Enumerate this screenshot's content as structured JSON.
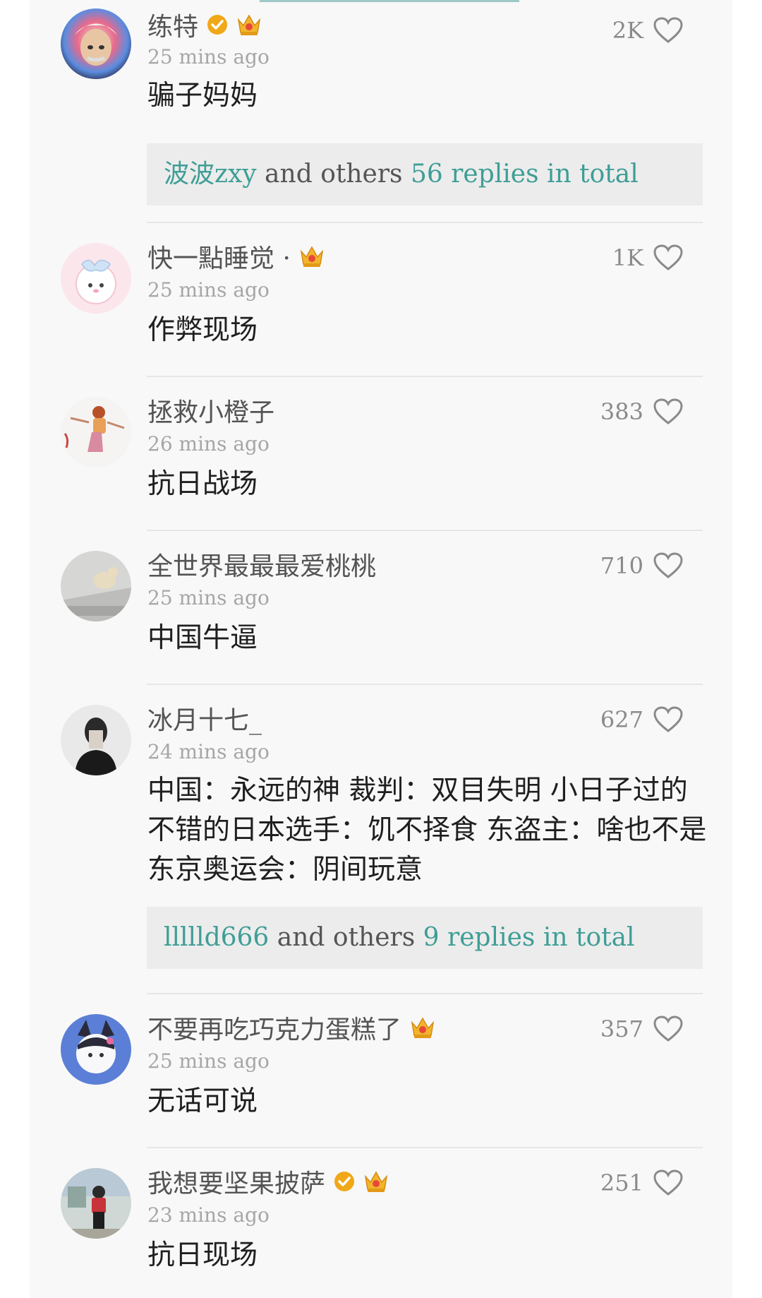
{
  "colors": {
    "accent": "#3f9e96",
    "verified": "#f0a818",
    "crown": "#f1b52c",
    "text": "#1f1f1f",
    "muted": "#a6a6a6"
  },
  "comments": [
    {
      "username": "练特",
      "badges": [
        "verified-icon",
        "crown-level-icon"
      ],
      "time": "25 mins ago",
      "likes": "2K",
      "text": "骗子妈妈",
      "replies": {
        "names": "波波zxy",
        "middle": " and others ",
        "total": "56 replies in total"
      }
    },
    {
      "username": "快一點睡觉 ·",
      "badges": [
        "crown-level-icon"
      ],
      "time": "25 mins ago",
      "likes": "1K",
      "text": "作弊现场"
    },
    {
      "username": "拯救小橙子",
      "badges": [],
      "time": "26 mins ago",
      "likes": "383",
      "text": "抗日战场"
    },
    {
      "username": "全世界最最最爱桃桃",
      "badges": [],
      "time": "25 mins ago",
      "likes": "710",
      "text": "中国牛逼"
    },
    {
      "username": "冰月十七_",
      "badges": [],
      "time": "24 mins ago",
      "likes": "627",
      "text": "中国：永远的神 裁判：双目失明 小日子过的不错的日本选手：饥不择食 东盗主：啥也不是 东京奥运会：阴间玩意",
      "replies": {
        "names": "llllld666",
        "middle": " and others ",
        "total": "9 replies in total"
      }
    },
    {
      "username": "不要再吃巧克力蛋糕了",
      "badges": [
        "crown-level-icon"
      ],
      "time": "25 mins ago",
      "likes": "357",
      "text": "无话可说"
    },
    {
      "username": "我想要坚果披萨",
      "badges": [
        "verified-icon",
        "crown-level-icon"
      ],
      "time": "23 mins ago",
      "likes": "251",
      "text": "抗日现场"
    }
  ]
}
